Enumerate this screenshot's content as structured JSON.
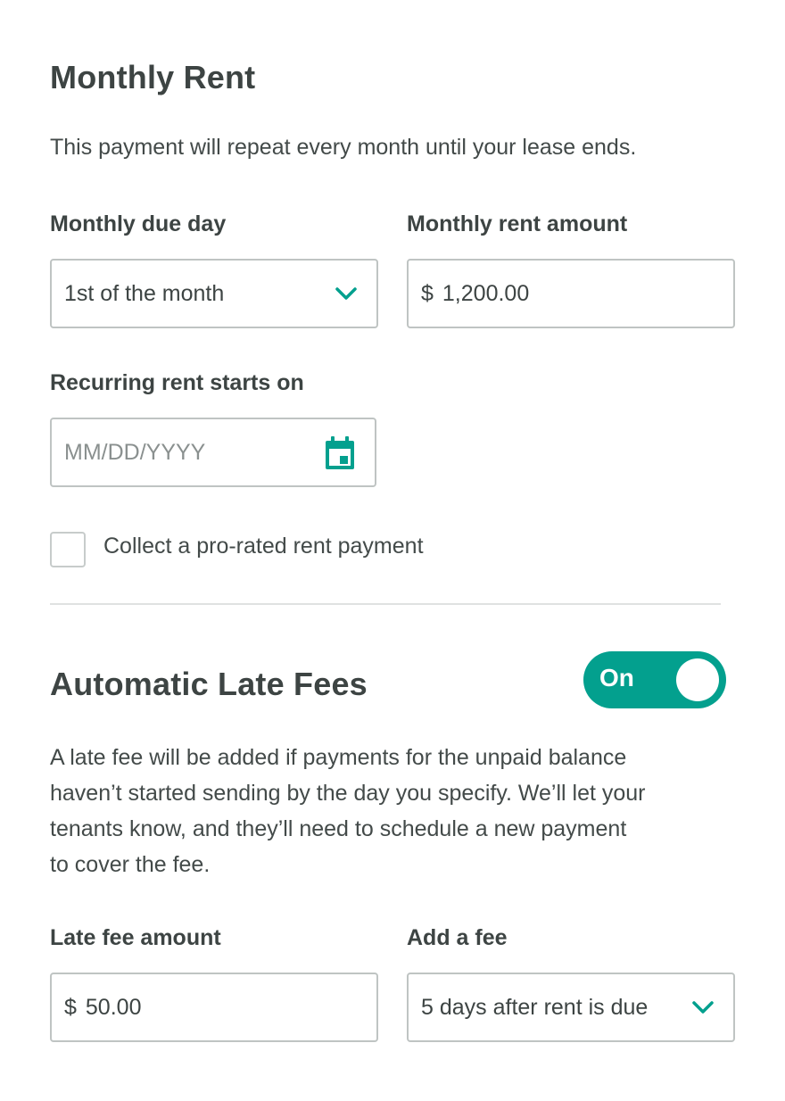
{
  "monthly_rent": {
    "title": "Monthly Rent",
    "description": "This payment will repeat every month until your lease ends.",
    "due_day": {
      "label": "Monthly due day",
      "value": "1st of the month"
    },
    "rent_amount": {
      "label": "Monthly rent amount",
      "currency": "$",
      "value": "1,200.00"
    },
    "start_date": {
      "label": "Recurring rent starts on",
      "placeholder": "MM/DD/YYYY"
    },
    "prorated": {
      "label": "Collect a pro-rated rent payment",
      "checked": false
    }
  },
  "late_fees": {
    "title": "Automatic Late Fees",
    "toggle": {
      "label": "On",
      "state": true
    },
    "description_lines": [
      "A late fee will be added if payments for the unpaid balance",
      "haven’t started sending by the day you specify. We’ll let your",
      "tenants know, and they’ll need to schedule a new payment",
      "to cover the fee."
    ],
    "fee_amount": {
      "label": "Late fee amount",
      "currency": "$",
      "value": "50.00"
    },
    "add_fee": {
      "label": "Add a fee",
      "value": "5 days after rent is due"
    }
  },
  "colors": {
    "accent": "#03a08e",
    "text": "#3d4443",
    "border": "#bfc4c3"
  },
  "icons": {
    "select": "chevron-down-icon",
    "date": "calendar-icon"
  }
}
